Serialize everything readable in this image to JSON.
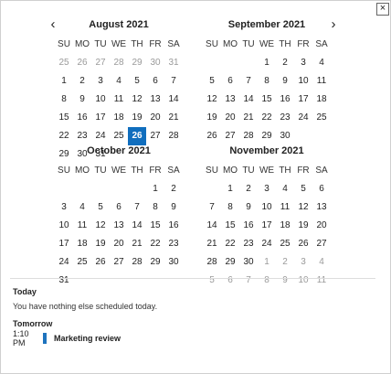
{
  "close_label": "×",
  "nav": {
    "prev": "‹",
    "next": "›"
  },
  "weekdays": [
    "SU",
    "MO",
    "TU",
    "WE",
    "TH",
    "FR",
    "SA"
  ],
  "months": [
    {
      "title": "August 2021",
      "weeks": [
        [
          {
            "d": "25",
            "o": true
          },
          {
            "d": "26",
            "o": true
          },
          {
            "d": "27",
            "o": true
          },
          {
            "d": "28",
            "o": true
          },
          {
            "d": "29",
            "o": true
          },
          {
            "d": "30",
            "o": true
          },
          {
            "d": "31",
            "o": true
          }
        ],
        [
          {
            "d": "1"
          },
          {
            "d": "2"
          },
          {
            "d": "3"
          },
          {
            "d": "4"
          },
          {
            "d": "5"
          },
          {
            "d": "6"
          },
          {
            "d": "7"
          }
        ],
        [
          {
            "d": "8"
          },
          {
            "d": "9"
          },
          {
            "d": "10"
          },
          {
            "d": "11"
          },
          {
            "d": "12"
          },
          {
            "d": "13"
          },
          {
            "d": "14"
          }
        ],
        [
          {
            "d": "15"
          },
          {
            "d": "16"
          },
          {
            "d": "17"
          },
          {
            "d": "18"
          },
          {
            "d": "19"
          },
          {
            "d": "20"
          },
          {
            "d": "21"
          }
        ],
        [
          {
            "d": "22"
          },
          {
            "d": "23"
          },
          {
            "d": "24"
          },
          {
            "d": "25"
          },
          {
            "d": "26",
            "s": true
          },
          {
            "d": "27"
          },
          {
            "d": "28"
          }
        ],
        [
          {
            "d": "29"
          },
          {
            "d": "30"
          },
          {
            "d": "31"
          },
          {
            "d": ""
          },
          {
            "d": ""
          },
          {
            "d": ""
          },
          {
            "d": ""
          }
        ]
      ]
    },
    {
      "title": "September 2021",
      "weeks": [
        [
          {
            "d": ""
          },
          {
            "d": ""
          },
          {
            "d": ""
          },
          {
            "d": "1"
          },
          {
            "d": "2"
          },
          {
            "d": "3"
          },
          {
            "d": "4"
          }
        ],
        [
          {
            "d": "5"
          },
          {
            "d": "6"
          },
          {
            "d": "7"
          },
          {
            "d": "8"
          },
          {
            "d": "9"
          },
          {
            "d": "10"
          },
          {
            "d": "11"
          }
        ],
        [
          {
            "d": "12"
          },
          {
            "d": "13"
          },
          {
            "d": "14"
          },
          {
            "d": "15"
          },
          {
            "d": "16"
          },
          {
            "d": "17"
          },
          {
            "d": "18"
          }
        ],
        [
          {
            "d": "19"
          },
          {
            "d": "20"
          },
          {
            "d": "21"
          },
          {
            "d": "22"
          },
          {
            "d": "23"
          },
          {
            "d": "24"
          },
          {
            "d": "25"
          }
        ],
        [
          {
            "d": "26"
          },
          {
            "d": "27"
          },
          {
            "d": "28"
          },
          {
            "d": "29"
          },
          {
            "d": "30"
          },
          {
            "d": ""
          },
          {
            "d": ""
          }
        ]
      ]
    },
    {
      "title": "October 2021",
      "weeks": [
        [
          {
            "d": ""
          },
          {
            "d": ""
          },
          {
            "d": ""
          },
          {
            "d": ""
          },
          {
            "d": ""
          },
          {
            "d": "1"
          },
          {
            "d": "2"
          }
        ],
        [
          {
            "d": "3"
          },
          {
            "d": "4"
          },
          {
            "d": "5"
          },
          {
            "d": "6"
          },
          {
            "d": "7"
          },
          {
            "d": "8"
          },
          {
            "d": "9"
          }
        ],
        [
          {
            "d": "10"
          },
          {
            "d": "11"
          },
          {
            "d": "12"
          },
          {
            "d": "13"
          },
          {
            "d": "14"
          },
          {
            "d": "15"
          },
          {
            "d": "16"
          }
        ],
        [
          {
            "d": "17"
          },
          {
            "d": "18"
          },
          {
            "d": "19"
          },
          {
            "d": "20"
          },
          {
            "d": "21"
          },
          {
            "d": "22"
          },
          {
            "d": "23"
          }
        ],
        [
          {
            "d": "24"
          },
          {
            "d": "25"
          },
          {
            "d": "26"
          },
          {
            "d": "27"
          },
          {
            "d": "28"
          },
          {
            "d": "29"
          },
          {
            "d": "30"
          }
        ],
        [
          {
            "d": "31"
          },
          {
            "d": ""
          },
          {
            "d": ""
          },
          {
            "d": ""
          },
          {
            "d": ""
          },
          {
            "d": ""
          },
          {
            "d": ""
          }
        ]
      ]
    },
    {
      "title": "November 2021",
      "weeks": [
        [
          {
            "d": ""
          },
          {
            "d": "1"
          },
          {
            "d": "2"
          },
          {
            "d": "3"
          },
          {
            "d": "4"
          },
          {
            "d": "5"
          },
          {
            "d": "6"
          }
        ],
        [
          {
            "d": "7"
          },
          {
            "d": "8"
          },
          {
            "d": "9"
          },
          {
            "d": "10"
          },
          {
            "d": "11"
          },
          {
            "d": "12"
          },
          {
            "d": "13"
          }
        ],
        [
          {
            "d": "14"
          },
          {
            "d": "15"
          },
          {
            "d": "16"
          },
          {
            "d": "17"
          },
          {
            "d": "18"
          },
          {
            "d": "19"
          },
          {
            "d": "20"
          }
        ],
        [
          {
            "d": "21"
          },
          {
            "d": "22"
          },
          {
            "d": "23"
          },
          {
            "d": "24"
          },
          {
            "d": "25"
          },
          {
            "d": "26"
          },
          {
            "d": "27"
          }
        ],
        [
          {
            "d": "28"
          },
          {
            "d": "29"
          },
          {
            "d": "30"
          },
          {
            "d": "1",
            "o": true
          },
          {
            "d": "2",
            "o": true
          },
          {
            "d": "3",
            "o": true
          },
          {
            "d": "4",
            "o": true
          }
        ],
        [
          {
            "d": "5",
            "o": true
          },
          {
            "d": "6",
            "o": true
          },
          {
            "d": "7",
            "o": true
          },
          {
            "d": "8",
            "o": true
          },
          {
            "d": "9",
            "o": true
          },
          {
            "d": "10",
            "o": true
          },
          {
            "d": "11",
            "o": true
          }
        ]
      ]
    }
  ],
  "agenda": {
    "today_title": "Today",
    "today_note": "You have nothing else scheduled today.",
    "tomorrow_title": "Tomorrow",
    "events": [
      {
        "time": "1:10 PM",
        "title": "Marketing review",
        "color": "#1e73be"
      }
    ]
  },
  "colors": {
    "selected": "#106ebe",
    "muted_day": "#9a9a9a"
  }
}
